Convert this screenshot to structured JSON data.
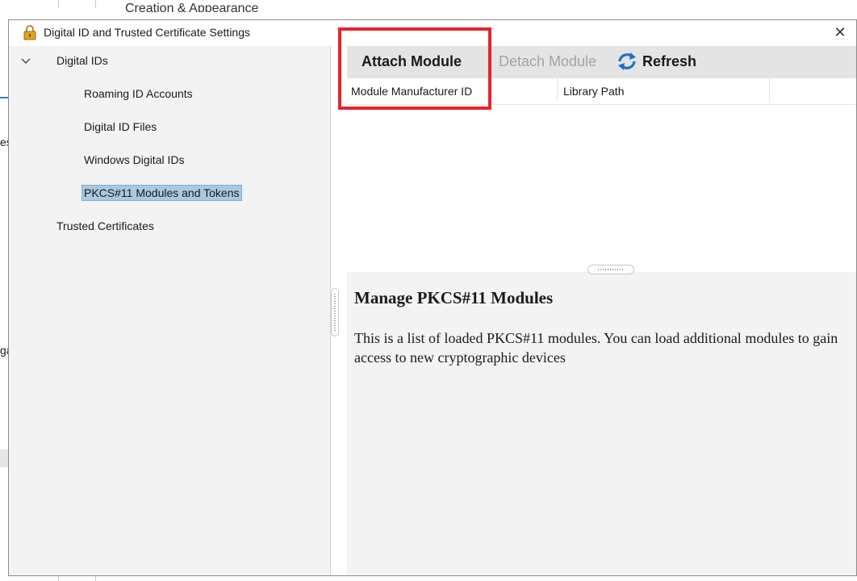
{
  "background": {
    "partial_title": "Creation & Appearance",
    "fragment_es": "es",
    "fragment_ga": "ga"
  },
  "dialog": {
    "title": "Digital ID and Trusted Certificate Settings",
    "close_symbol": "✕"
  },
  "tree": {
    "items": [
      {
        "label": "Digital IDs",
        "expanded": true
      },
      {
        "label": "Roaming ID Accounts"
      },
      {
        "label": "Digital ID Files"
      },
      {
        "label": "Windows Digital IDs"
      },
      {
        "label": "PKCS#11 Modules and Tokens",
        "selected": true
      },
      {
        "label": "Trusted Certificates"
      }
    ]
  },
  "toolbar": {
    "attach_label": "Attach Module",
    "detach_label": "Detach Module",
    "refresh_label": "Refresh"
  },
  "table": {
    "columns": [
      "Module Manufacturer ID",
      "Library Path"
    ]
  },
  "info": {
    "title": "Manage PKCS#11 Modules",
    "body": "This is a list of loaded PKCS#11 modules. You can load additional modules to gain access to new cryptographic devices"
  },
  "colors": {
    "highlight": "#e8232d",
    "selection": "#a9c8e2",
    "toolbar_bg": "#e4e4e4",
    "disabled_text": "#a3a3a3"
  }
}
